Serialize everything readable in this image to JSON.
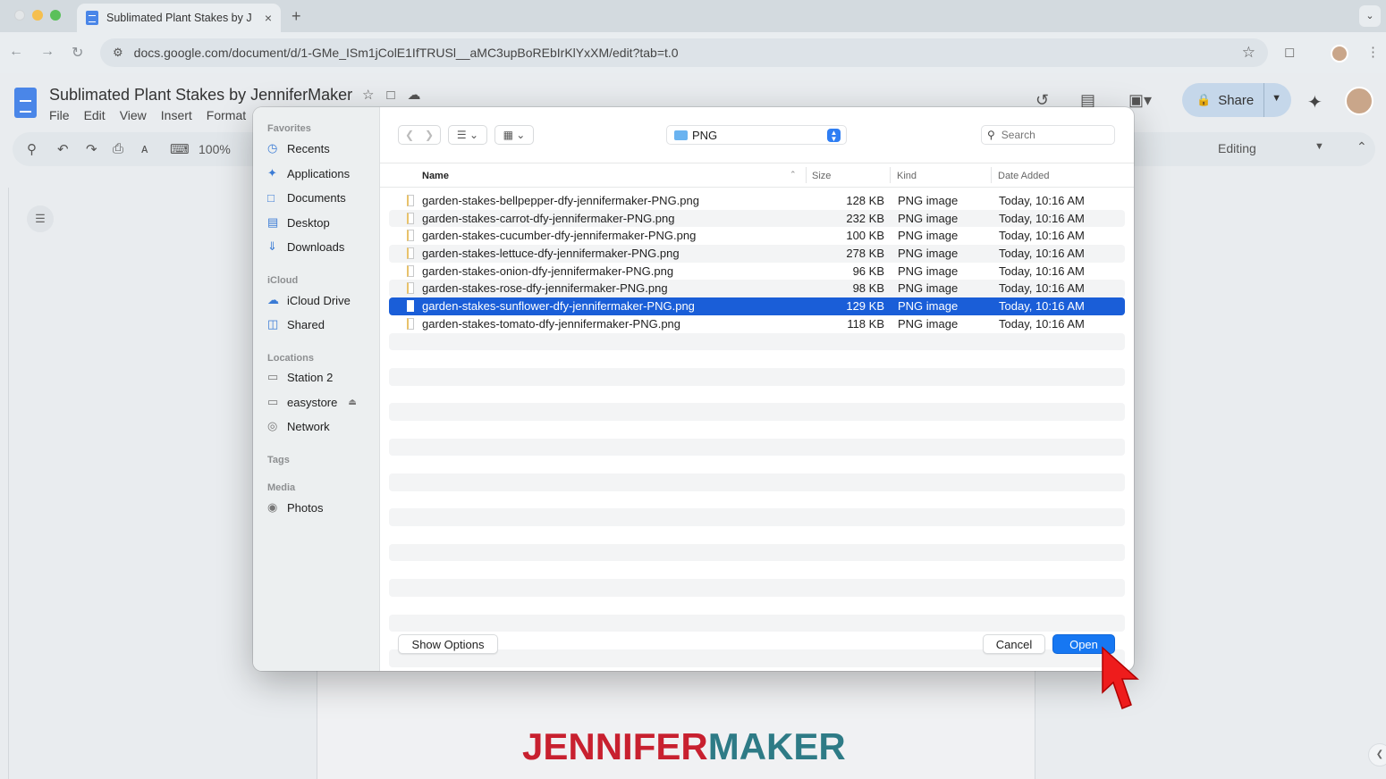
{
  "browser": {
    "tab_title": "Sublimated Plant Stakes by J",
    "tab_close": "×",
    "new_tab": "+",
    "url": "docs.google.com/document/d/1-GMe_ISm1jColE1IfTRUSl__aMC3upBoREbIrKlYxXM/edit?tab=t.0"
  },
  "docs": {
    "title": "Sublimated Plant Stakes by JenniferMaker",
    "menu": [
      "File",
      "Edit",
      "View",
      "Insert",
      "Format"
    ],
    "zoom": "100%",
    "share_label": "Share",
    "editing_label": "Editing"
  },
  "dialog": {
    "sidebar": {
      "favorites_label": "Favorites",
      "favorites": [
        "Recents",
        "Applications",
        "Documents",
        "Desktop",
        "Downloads"
      ],
      "icloud_label": "iCloud",
      "icloud": [
        "iCloud Drive",
        "Shared"
      ],
      "locations_label": "Locations",
      "locations": [
        "Station 2",
        "easystore",
        "Network"
      ],
      "tags_label": "Tags",
      "media_label": "Media",
      "media": [
        "Photos"
      ]
    },
    "folder": "PNG",
    "search_placeholder": "Search",
    "columns": {
      "name": "Name",
      "size": "Size",
      "kind": "Kind",
      "date": "Date Added"
    },
    "files": [
      {
        "name": "garden-stakes-bellpepper-dfy-jennifermaker-PNG.png",
        "size": "128 KB",
        "kind": "PNG image",
        "date": "Today, 10:16 AM"
      },
      {
        "name": "garden-stakes-carrot-dfy-jennifermaker-PNG.png",
        "size": "232 KB",
        "kind": "PNG image",
        "date": "Today, 10:16 AM"
      },
      {
        "name": "garden-stakes-cucumber-dfy-jennifermaker-PNG.png",
        "size": "100 KB",
        "kind": "PNG image",
        "date": "Today, 10:16 AM"
      },
      {
        "name": "garden-stakes-lettuce-dfy-jennifermaker-PNG.png",
        "size": "278 KB",
        "kind": "PNG image",
        "date": "Today, 10:16 AM"
      },
      {
        "name": "garden-stakes-onion-dfy-jennifermaker-PNG.png",
        "size": "96 KB",
        "kind": "PNG image",
        "date": "Today, 10:16 AM"
      },
      {
        "name": "garden-stakes-rose-dfy-jennifermaker-PNG.png",
        "size": "98 KB",
        "kind": "PNG image",
        "date": "Today, 10:16 AM"
      },
      {
        "name": "garden-stakes-sunflower-dfy-jennifermaker-PNG.png",
        "size": "129 KB",
        "kind": "PNG image",
        "date": "Today, 10:16 AM"
      },
      {
        "name": "garden-stakes-tomato-dfy-jennifermaker-PNG.png",
        "size": "118 KB",
        "kind": "PNG image",
        "date": "Today, 10:16 AM"
      }
    ],
    "selected_index": 6,
    "show_options_label": "Show Options",
    "cancel_label": "Cancel",
    "open_label": "Open"
  },
  "brand": {
    "part1": "JENNIFER",
    "part2": "MAKER"
  },
  "colors": {
    "selection": "#1a5ed8",
    "primary_button": "#1677f2",
    "brand_red": "#c8202f",
    "brand_teal": "#2e7b86"
  }
}
